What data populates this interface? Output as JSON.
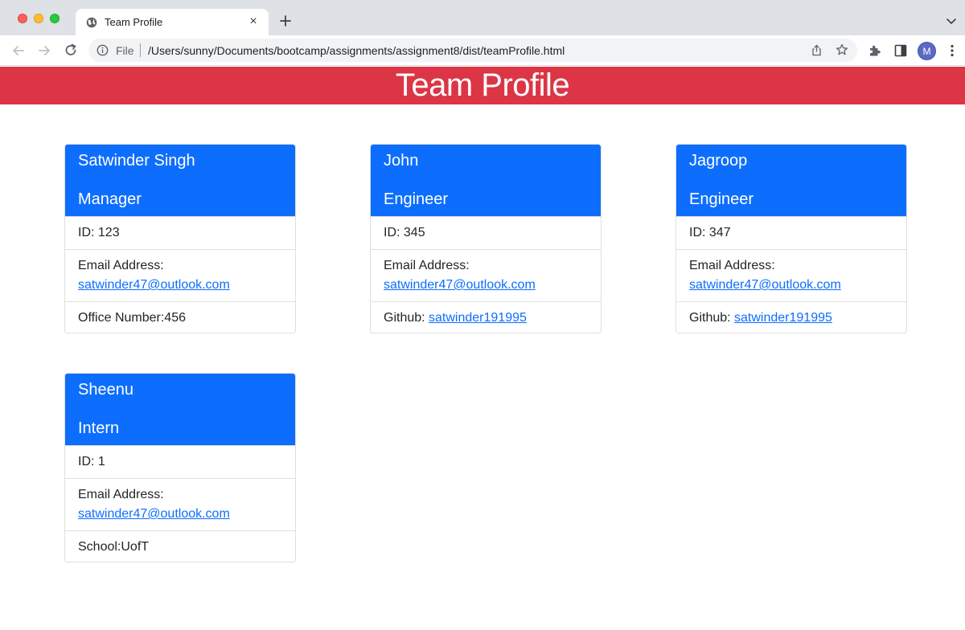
{
  "browser": {
    "tab_title": "Team Profile",
    "tab_close": "×",
    "scheme_label": "File",
    "url": "/Users/sunny/Documents/bootcamp/assignments/assignment8/dist/teamProfile.html",
    "avatar_initial": "M"
  },
  "page": {
    "title": "Team Profile",
    "colors": {
      "banner": "#dc3545",
      "card_header": "#0d6efd",
      "link": "#0d6efd"
    }
  },
  "cards": [
    {
      "name": "Satwinder Singh",
      "role": "Manager",
      "id_text": "ID: 123",
      "email_label": "Email Address:",
      "email": "satwinder47@outlook.com",
      "extra_label": "Office Number:456",
      "extra_link": ""
    },
    {
      "name": "John",
      "role": "Engineer",
      "id_text": "ID: 345",
      "email_label": "Email Address:",
      "email": "satwinder47@outlook.com",
      "extra_label": "Github: ",
      "extra_link": "satwinder191995"
    },
    {
      "name": "Jagroop",
      "role": "Engineer",
      "id_text": "ID: 347",
      "email_label": "Email Address:",
      "email": "satwinder47@outlook.com",
      "extra_label": "Github: ",
      "extra_link": "satwinder191995"
    },
    {
      "name": "Sheenu",
      "role": "Intern",
      "id_text": "ID: 1",
      "email_label": "Email Address:",
      "email": "satwinder47@outlook.com",
      "extra_label": "School:UofT",
      "extra_link": ""
    }
  ]
}
